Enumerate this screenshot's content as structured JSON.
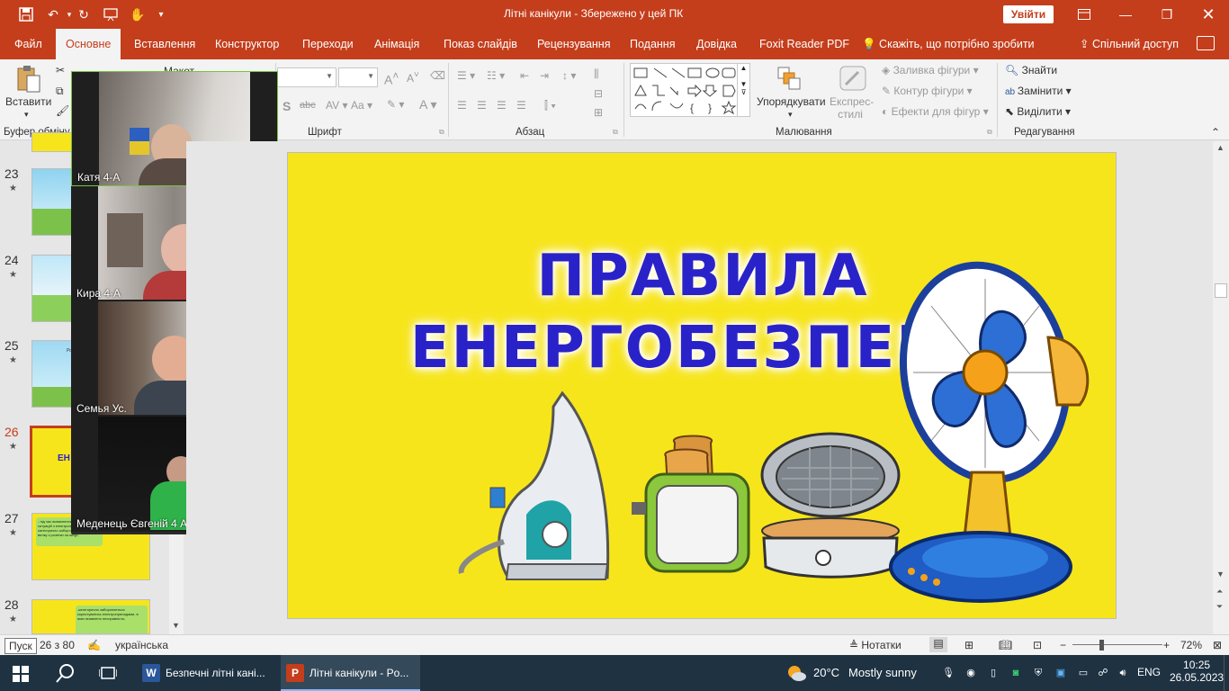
{
  "titlebar": {
    "doc_title": "Літні канікули  -  Збережено у цей ПК",
    "signin": "Увійти"
  },
  "tabs": [
    "Файл",
    "Основне",
    "Вставлення",
    "Конструктор",
    "Переходи",
    "Анімація",
    "Показ слайдів",
    "Рецензування",
    "Подання",
    "Довідка",
    "Foxit Reader PDF"
  ],
  "tellme": "Скажіть, що потрібно зробити",
  "share": "Спільний доступ",
  "ribbon": {
    "paste": "Вставити",
    "clipboard_label": "Буфер обміну",
    "font_label": "Шрифт",
    "paragraph_label": "Абзац",
    "drawing_label": "Малювання",
    "editing_label": "Редагування",
    "layout_partial": "Макет",
    "arrange": "Упорядкувати",
    "quick_styles": "Експрес-стилі",
    "shape_fill": "Заливка фігури",
    "shape_outline": "Контур фігури",
    "shape_effects": "Ефекти для фігур",
    "find": "Знайти",
    "replace": "Замінити",
    "select": "Виділити"
  },
  "thumbnails": [
    {
      "num": "23",
      "selected": false
    },
    {
      "num": "24",
      "selected": false
    },
    {
      "num": "25",
      "selected": false
    },
    {
      "num": "26",
      "selected": true
    },
    {
      "num": "27",
      "selected": false
    },
    {
      "num": "28",
      "selected": false
    }
  ],
  "thumb_texts": {
    "t25": "Розетка",
    "t26": "ЕН",
    "t27": "- під час виникнення аварійних ситуацій з електроприладами категорично забороняється вмикати вилку з розетки за шнур;",
    "t28": "-категорично забороняється користуватись електроприладами, в яких виявлено несправність;"
  },
  "videos": [
    {
      "name": "Катя  4-А",
      "active": true
    },
    {
      "name": "Кира 4-А",
      "active": false
    },
    {
      "name": "Семья Ус.",
      "active": false
    },
    {
      "name": "Меденець Євгеній 4 А",
      "active": false
    }
  ],
  "slide": {
    "title_line1": "ПРАВИЛА",
    "title_line2": "ЕНЕРГОБЕЗПЕКИ",
    "background": "#f7e51c",
    "title_color": "#2a22c9"
  },
  "statusbar": {
    "start_tip": "Пуск",
    "slide_counter": "26 з 80",
    "language": "українська",
    "notes": "Нотатки",
    "zoom": "72%"
  },
  "taskbar": {
    "word_app": "Безпечні літні кані...",
    "ppt_app": "Літні канікули - Po...",
    "weather_temp": "20°C",
    "weather_text": "Mostly sunny",
    "lang": "ENG",
    "time": "10:25",
    "date": "26.05.2023"
  },
  "colors": {
    "accent": "#c43e1c",
    "taskbar": "#1e3242"
  }
}
